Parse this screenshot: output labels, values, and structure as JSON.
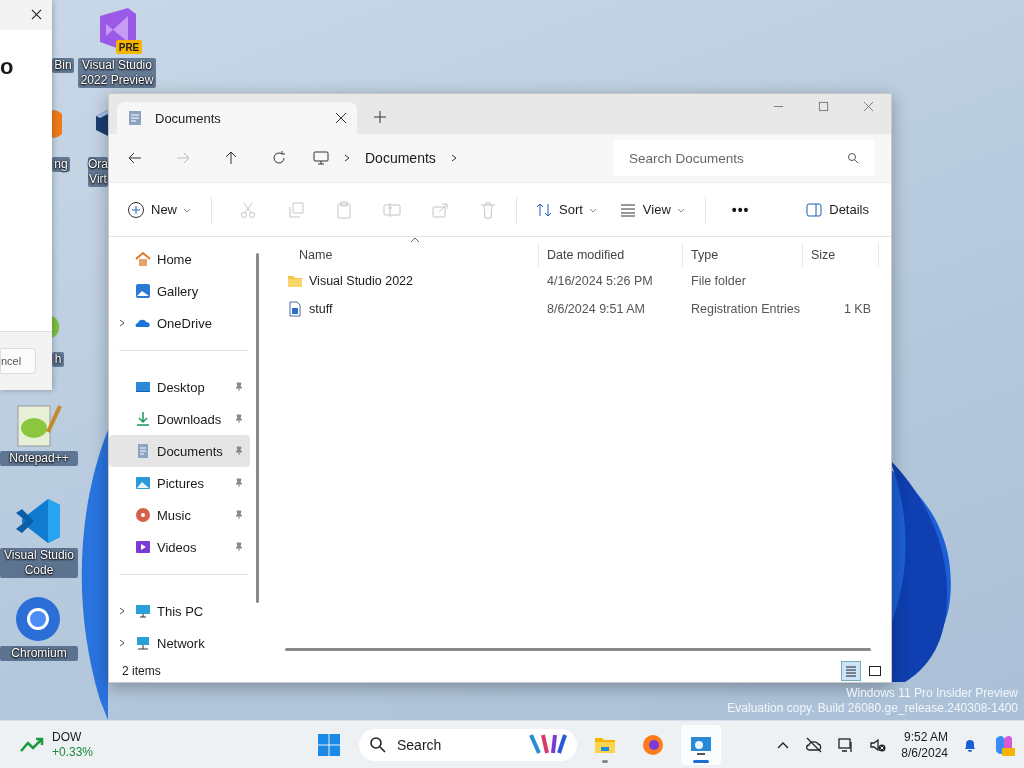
{
  "desktop": {
    "icons": [
      {
        "kind": "hidden",
        "label": "Bin"
      },
      {
        "kind": "visual-studio-preview",
        "label": "Visual Studio 2022 Preview",
        "badge": "PRE"
      },
      {
        "kind": "orange-app",
        "label": "ng"
      },
      {
        "kind": "virtualbox",
        "label": "Ora Virt"
      },
      {
        "kind": "yellow-app",
        "label": "h"
      },
      {
        "kind": "notepadpp",
        "label": "Notepad++"
      },
      {
        "kind": "vscode",
        "label": "Visual Studio Code"
      },
      {
        "kind": "chromium",
        "label": "Chromium"
      }
    ]
  },
  "dialog": {
    "heading": "o",
    "button": "ncel"
  },
  "explorer": {
    "tabs": [
      {
        "label": "Documents",
        "selected": true
      }
    ],
    "breadcrumb": [
      "Documents"
    ],
    "search": {
      "placeholder": "Search Documents"
    },
    "toolbar": [
      {
        "kind": "new",
        "label": "New",
        "menu": true,
        "disabled": false
      },
      {
        "kind": "cut",
        "disabled": true
      },
      {
        "kind": "copy",
        "disabled": true
      },
      {
        "kind": "paste",
        "disabled": true
      },
      {
        "kind": "rename",
        "disabled": true
      },
      {
        "kind": "share",
        "disabled": true
      },
      {
        "kind": "delete",
        "disabled": true
      },
      {
        "kind": "sort",
        "label": "Sort",
        "menu": true,
        "disabled": false
      },
      {
        "kind": "view",
        "label": "View",
        "menu": true,
        "disabled": false
      },
      {
        "kind": "more",
        "label": "•••",
        "disabled": false
      },
      {
        "kind": "details",
        "label": "Details",
        "disabled": false
      }
    ],
    "sidebar": [
      [
        {
          "kind": "home",
          "label": "Home",
          "selected": false
        },
        {
          "kind": "gallery",
          "label": "Gallery",
          "selected": false
        },
        {
          "kind": "onedrive",
          "label": "OneDrive",
          "expanded": false,
          "selected": false
        }
      ],
      [
        {
          "kind": "desktop",
          "label": "Desktop",
          "pinned": true,
          "selected": false
        },
        {
          "kind": "downloads",
          "label": "Downloads",
          "pinned": true,
          "selected": false
        },
        {
          "kind": "documents",
          "label": "Documents",
          "pinned": true,
          "selected": true
        },
        {
          "kind": "pictures",
          "label": "Pictures",
          "pinned": true,
          "selected": false
        },
        {
          "kind": "music",
          "label": "Music",
          "pinned": true,
          "selected": false
        },
        {
          "kind": "videos",
          "label": "Videos",
          "pinned": true,
          "selected": false
        }
      ],
      [
        {
          "kind": "thispc",
          "label": "This PC",
          "expanded": false,
          "selected": false
        },
        {
          "kind": "network",
          "label": "Network",
          "expanded": false,
          "selected": false
        }
      ]
    ],
    "columns": [
      "Name",
      "Date modified",
      "Type",
      "Size"
    ],
    "rows": [
      {
        "kind": "folder",
        "name": "Visual Studio 2022",
        "date": "4/16/2024 5:26 PM",
        "type": "File folder",
        "selected": false
      },
      {
        "kind": "registry",
        "name": "stuff",
        "date": "8/6/2024 9:51 AM",
        "type": "Registration Entries",
        "size": "1 KB",
        "selected": false
      }
    ],
    "status": "2 items",
    "views": [
      {
        "kind": "details",
        "selected": true
      },
      {
        "kind": "tiles",
        "selected": false
      }
    ]
  },
  "watermark": [
    "Windows 11 Pro Insider Preview",
    "Evaluation copy. Build 26080.ge_release.240308-1400"
  ],
  "taskbar": {
    "widget": {
      "name": "DOW",
      "change": "+0.33%"
    },
    "search": "Search",
    "apps": [
      {
        "kind": "explorer",
        "active": false,
        "running": true
      },
      {
        "kind": "firefox",
        "active": false,
        "running": false
      },
      {
        "kind": "remote-desktop",
        "active": true,
        "running": true
      }
    ],
    "time": "9:52 AM",
    "date": "8/6/2024"
  }
}
